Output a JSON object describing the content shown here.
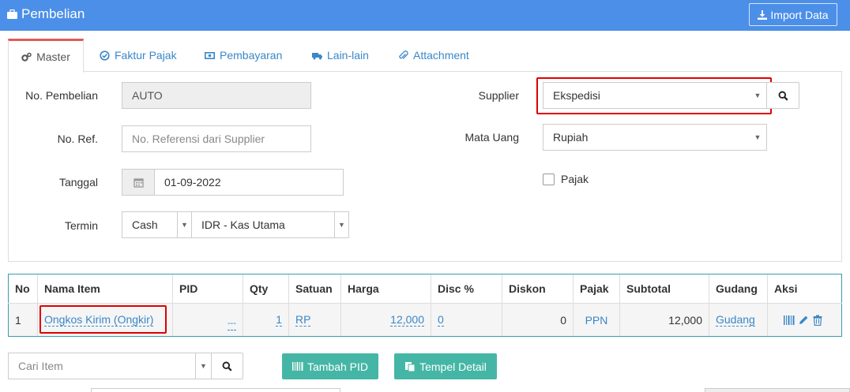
{
  "header": {
    "title": "Pembelian",
    "import_label": "Import Data"
  },
  "tabs": [
    {
      "label": "Master",
      "icon": "gears-icon"
    },
    {
      "label": "Faktur Pajak",
      "icon": "check-circle-icon"
    },
    {
      "label": "Pembayaran",
      "icon": "money-icon"
    },
    {
      "label": "Lain-lain",
      "icon": "truck-icon"
    },
    {
      "label": "Attachment",
      "icon": "paperclip-icon"
    }
  ],
  "form": {
    "no_pembelian": {
      "label": "No. Pembelian",
      "value": "AUTO"
    },
    "no_ref": {
      "label": "No. Ref.",
      "placeholder": "No. Referensi dari Supplier"
    },
    "tanggal": {
      "label": "Tanggal",
      "value": "01-09-2022"
    },
    "termin": {
      "label": "Termin",
      "value": "Cash",
      "account": "IDR - Kas Utama"
    },
    "supplier": {
      "label": "Supplier",
      "value": "Ekspedisi"
    },
    "mata_uang": {
      "label": "Mata Uang",
      "value": "Rupiah"
    },
    "pajak": {
      "label": "Pajak",
      "checked": false
    }
  },
  "table": {
    "headers": [
      "No",
      "Nama Item",
      "PID",
      "Qty",
      "Satuan",
      "Harga",
      "Disc %",
      "Diskon",
      "Pajak",
      "Subtotal",
      "Gudang",
      "Aksi"
    ],
    "rows": [
      {
        "no": "1",
        "nama_item": "Ongkos Kirim (Ongkir)",
        "pid": "---",
        "qty": "1",
        "satuan": "RP",
        "harga": "12,000",
        "disc": "0",
        "diskon": "0",
        "pajak": "PPN",
        "subtotal": "12,000",
        "gudang": "Gudang"
      }
    ]
  },
  "footer": {
    "search_placeholder": "Cari Item",
    "tambah_pid_label": "Tambah PID",
    "tempel_detail_label": "Tempel Detail"
  },
  "colors": {
    "header_bg": "#4b8fe8",
    "accent_teal": "#45b6a5",
    "link": "#3a87c8",
    "highlight": "#e00000"
  }
}
